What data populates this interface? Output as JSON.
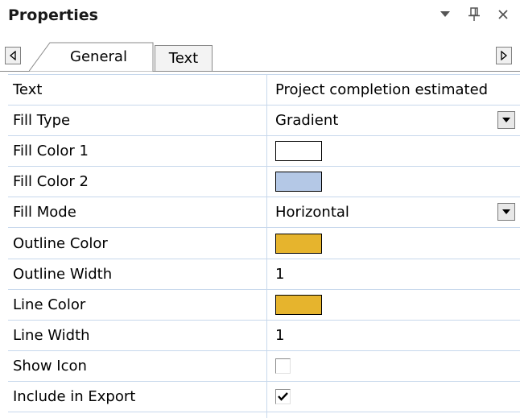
{
  "panel": {
    "title": "Properties"
  },
  "tabs": [
    {
      "label": "General",
      "selected": true
    },
    {
      "label": "Text",
      "selected": false
    }
  ],
  "properties": [
    {
      "name": "Text",
      "value": "Project completion estimated",
      "type": "text"
    },
    {
      "name": "Fill Type",
      "value": "Gradient",
      "type": "dropdown"
    },
    {
      "name": "Fill Color 1",
      "value": "#ffffff",
      "type": "color"
    },
    {
      "name": "Fill Color 2",
      "value": "#b4c8e6",
      "type": "color"
    },
    {
      "name": "Fill Mode",
      "value": "Horizontal",
      "type": "dropdown"
    },
    {
      "name": "Outline Color",
      "value": "#e6b42d",
      "type": "color"
    },
    {
      "name": "Outline Width",
      "value": "1",
      "type": "text"
    },
    {
      "name": "Line Color",
      "value": "#e6b42d",
      "type": "color"
    },
    {
      "name": "Line Width",
      "value": "1",
      "type": "text"
    },
    {
      "name": "Show Icon",
      "value": false,
      "type": "checkbox"
    },
    {
      "name": "Include in Export",
      "value": true,
      "type": "checkbox"
    }
  ],
  "icons": {
    "title_bar": [
      "dropdown-arrow-icon",
      "pin-icon",
      "close-icon"
    ],
    "tab_scroll": [
      "scroll-left-icon",
      "scroll-right-icon"
    ]
  },
  "colors": {
    "grid_line": "#c7d8ec",
    "tab_border": "#8a8a8a"
  }
}
